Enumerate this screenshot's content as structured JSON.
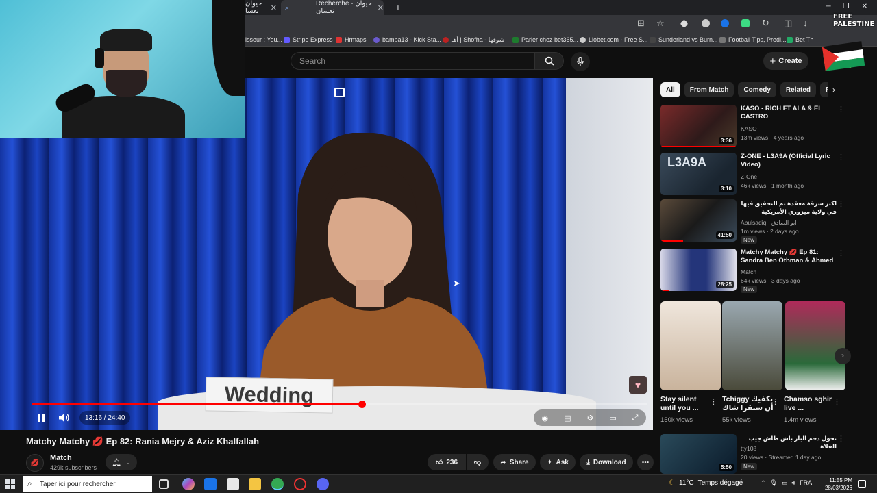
{
  "browser": {
    "tabs": [
      {
        "label": "حيوان نعسا"
      },
      {
        "label": "Recherche - حيوان نعسان"
      }
    ],
    "bookmarks": [
      {
        "label": "isseur : You...",
        "color": "#e33"
      },
      {
        "label": "Stripe Express",
        "color": "#635bff"
      },
      {
        "label": "Hrmaps",
        "color": "#d33"
      },
      {
        "label": "bamba13 - Kick Sta...",
        "color": "#6a5acd"
      },
      {
        "label": "أهـ | Shofha - شوفها",
        "color": "#b22"
      },
      {
        "label": "Parier chez bet365...",
        "color": "#1e7b2e"
      },
      {
        "label": "Liobet.com - Free S...",
        "color": "#ccc"
      },
      {
        "label": "Sunderland vs Burn...",
        "color": "#444"
      },
      {
        "label": "Football Tips, Predi...",
        "color": "#777"
      },
      {
        "label": "Bet Th",
        "color": "#2a6"
      }
    ]
  },
  "header": {
    "search_placeholder": "Search",
    "create_label": "Create"
  },
  "badge": {
    "line1": "FREE",
    "line2": "PALESTINE"
  },
  "player": {
    "name_card": "Wedding",
    "time": "13:16 / 24:40",
    "progress": 0.537,
    "accent": "#ff0000"
  },
  "video": {
    "title": "Matchy Matchy 💋 Ep 82: Rania Mejry & Aziz Khalfallah",
    "channel": "Match",
    "subscribers": "429k subscribers",
    "likes": "236",
    "share_label": "Share",
    "ask_label": "Ask",
    "download_label": "Download"
  },
  "chips": [
    "All",
    "From Match",
    "Comedy",
    "Related",
    "Fo"
  ],
  "recommendations": [
    {
      "title": "KASO - RICH FT ALA & EL CASTRO",
      "channel": "KASO",
      "stats": "13m views · 4 years ago",
      "duration": "3:36",
      "new": "",
      "thumb": "#6a2a2a"
    },
    {
      "title": "Z-ONE - L3A9A (Official Lyric Video)",
      "channel": "Z-One",
      "stats": "46k views · 1 month ago",
      "duration": "3:10",
      "new": "",
      "thumb": "#2a3a4a"
    },
    {
      "title": "اكثر سرقة معقدة تم التحقيق فيها في ولاية ميزوري الأمريكية",
      "channel": "Abulsadiq · ابو الصادق",
      "stats": "1m views · 2 days ago",
      "duration": "41:50",
      "new": "New",
      "thumb": "#3a3030"
    },
    {
      "title": "Matchy Matchy 💋 Ep 81: Sandra Ben Othman & Ahmed ...",
      "channel": "Match",
      "stats": "64k views · 3 days ago",
      "duration": "28:25",
      "new": "New",
      "thumb": "#22306a"
    },
    {
      "title": "تحول دحم البار باش طاش جيب الفلاة",
      "channel": "tty108",
      "stats": "20 views · Streamed 1 day ago",
      "duration": "5:50",
      "new": "New",
      "thumb": "#1a3a4a"
    }
  ],
  "shorts": [
    {
      "title": "Stay silent until you ...",
      "views": "150k views",
      "color": "#d8c8b8"
    },
    {
      "title": "Tchiggy يكفيك أن ستقرا شاك",
      "views": "55k views",
      "color": "#6a6a5a"
    },
    {
      "title": "Chamso sghir live ...",
      "views": "1.4m views",
      "color": "#8a2a6a"
    }
  ],
  "taskbar": {
    "search_placeholder": "Taper ici pour rechercher",
    "temperature": "11°C",
    "weather": "Temps dégagé",
    "lang": "FRA",
    "time": "11:55 PM",
    "date": "28/03/2026"
  }
}
